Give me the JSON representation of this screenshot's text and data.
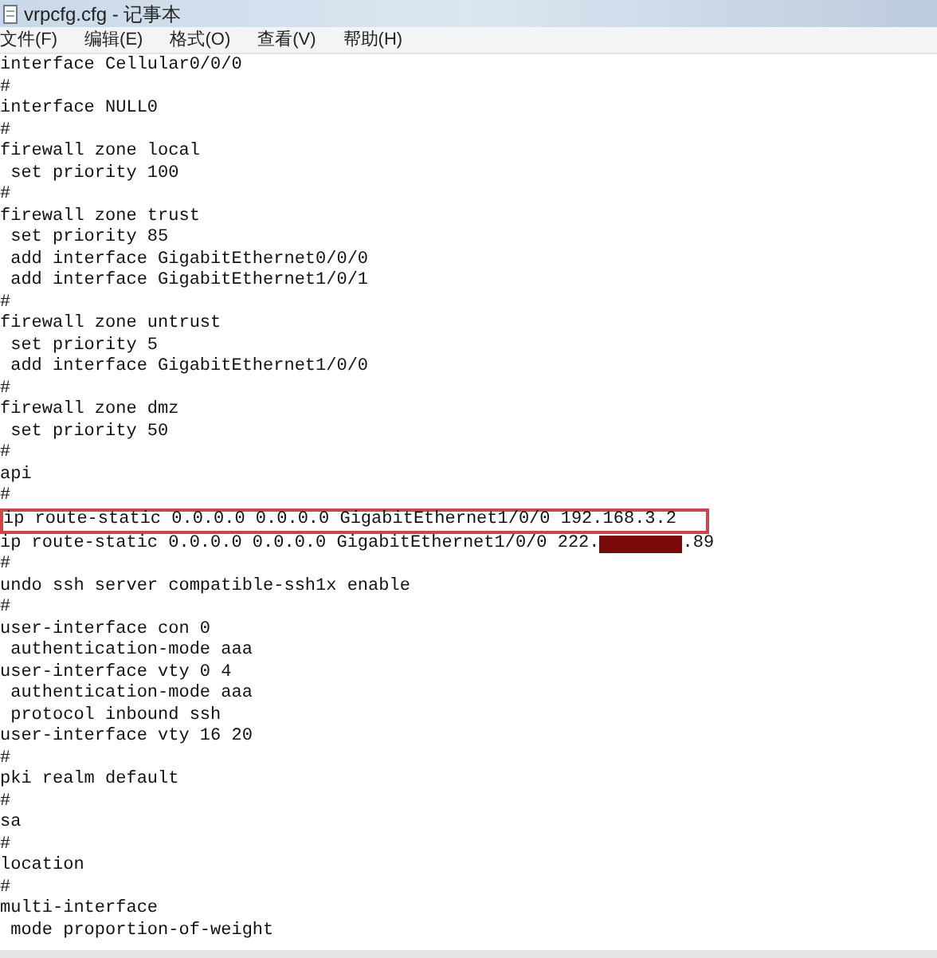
{
  "window": {
    "title": "vrpcfg.cfg - 记事本"
  },
  "menu": [
    "文件(F)",
    "编辑(E)",
    "格式(O)",
    "查看(V)",
    "帮助(H)"
  ],
  "lines": [
    {
      "kind": "text",
      "text": "interface Cellular0/0/0",
      "highlighted": false
    },
    {
      "kind": "text",
      "text": "#",
      "highlighted": false
    },
    {
      "kind": "text",
      "text": "interface NULL0",
      "highlighted": false
    },
    {
      "kind": "text",
      "text": "#",
      "highlighted": false
    },
    {
      "kind": "text",
      "text": "firewall zone local",
      "highlighted": false
    },
    {
      "kind": "text",
      "text": " set priority 100",
      "highlighted": false
    },
    {
      "kind": "text",
      "text": "#",
      "highlighted": false
    },
    {
      "kind": "text",
      "text": "firewall zone trust",
      "highlighted": false
    },
    {
      "kind": "text",
      "text": " set priority 85",
      "highlighted": false
    },
    {
      "kind": "text",
      "text": " add interface GigabitEthernet0/0/0",
      "highlighted": false
    },
    {
      "kind": "text",
      "text": " add interface GigabitEthernet1/0/1",
      "highlighted": false
    },
    {
      "kind": "text",
      "text": "#",
      "highlighted": false
    },
    {
      "kind": "text",
      "text": "firewall zone untrust",
      "highlighted": false
    },
    {
      "kind": "text",
      "text": " set priority 5",
      "highlighted": false
    },
    {
      "kind": "text",
      "text": " add interface GigabitEthernet1/0/0",
      "highlighted": false
    },
    {
      "kind": "text",
      "text": "#",
      "highlighted": false
    },
    {
      "kind": "text",
      "text": "firewall zone dmz",
      "highlighted": false
    },
    {
      "kind": "text",
      "text": " set priority 50",
      "highlighted": false
    },
    {
      "kind": "text",
      "text": "#",
      "highlighted": false
    },
    {
      "kind": "text",
      "text": "api",
      "highlighted": false
    },
    {
      "kind": "text",
      "text": "#",
      "highlighted": false
    },
    {
      "kind": "text",
      "text": "ip route-static 0.0.0.0 0.0.0.0 GigabitEthernet1/0/0 192.168.3.2",
      "highlighted": true
    },
    {
      "kind": "redacted",
      "before": "ip route-static 0.0.0.0 0.0.0.0 GigabitEthernet1/0/0 222.",
      "after": ".89",
      "highlighted": false
    },
    {
      "kind": "text",
      "text": "#",
      "highlighted": false
    },
    {
      "kind": "text",
      "text": "undo ssh server compatible-ssh1x enable",
      "highlighted": false
    },
    {
      "kind": "text",
      "text": "#",
      "highlighted": false
    },
    {
      "kind": "text",
      "text": "user-interface con 0",
      "highlighted": false
    },
    {
      "kind": "text",
      "text": " authentication-mode aaa",
      "highlighted": false
    },
    {
      "kind": "text",
      "text": "user-interface vty 0 4",
      "highlighted": false
    },
    {
      "kind": "text",
      "text": " authentication-mode aaa",
      "highlighted": false
    },
    {
      "kind": "text",
      "text": " protocol inbound ssh",
      "highlighted": false
    },
    {
      "kind": "text",
      "text": "user-interface vty 16 20",
      "highlighted": false
    },
    {
      "kind": "text",
      "text": "#",
      "highlighted": false
    },
    {
      "kind": "text",
      "text": "pki realm default",
      "highlighted": false
    },
    {
      "kind": "text",
      "text": "#",
      "highlighted": false
    },
    {
      "kind": "text",
      "text": "sa",
      "highlighted": false
    },
    {
      "kind": "text",
      "text": "#",
      "highlighted": false
    },
    {
      "kind": "text",
      "text": "location",
      "highlighted": false
    },
    {
      "kind": "text",
      "text": "#",
      "highlighted": false
    },
    {
      "kind": "text",
      "text": "multi-interface",
      "highlighted": false
    },
    {
      "kind": "text",
      "text": " mode proportion-of-weight",
      "highlighted": false
    }
  ]
}
